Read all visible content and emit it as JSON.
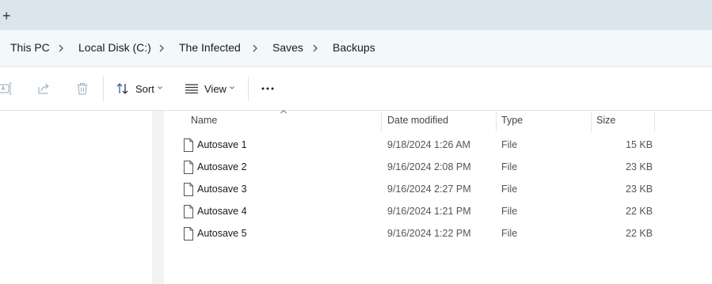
{
  "tabs": {
    "new_tab_glyph": "+"
  },
  "breadcrumb": [
    "This PC",
    "Local Disk (C:)",
    "The Infected",
    "Saves",
    "Backups"
  ],
  "toolbar": {
    "sort_label": "Sort",
    "view_label": "View",
    "more_label": "···",
    "icons": [
      "rename-icon",
      "share-icon",
      "delete-icon",
      "sort-icon",
      "view-icon",
      "more-icon"
    ]
  },
  "columns": {
    "name": "Name",
    "date": "Date modified",
    "type": "Type",
    "size": "Size"
  },
  "files": [
    {
      "name": "Autosave 1",
      "date": "9/18/2024 1:26 AM",
      "type": "File",
      "size": "15 KB"
    },
    {
      "name": "Autosave 2",
      "date": "9/16/2024 2:08 PM",
      "type": "File",
      "size": "23 KB"
    },
    {
      "name": "Autosave 3",
      "date": "9/16/2024 2:27 PM",
      "type": "File",
      "size": "23 KB"
    },
    {
      "name": "Autosave 4",
      "date": "9/16/2024 1:21 PM",
      "type": "File",
      "size": "22 KB"
    },
    {
      "name": "Autosave 5",
      "date": "9/16/2024 1:22 PM",
      "type": "File",
      "size": "22 KB"
    }
  ],
  "colors": {
    "tabstrip": "#dbe6ec",
    "addressbar": "#f3f8fa",
    "icon_gray": "#a9b6c2",
    "text": "#1a1a1a"
  }
}
